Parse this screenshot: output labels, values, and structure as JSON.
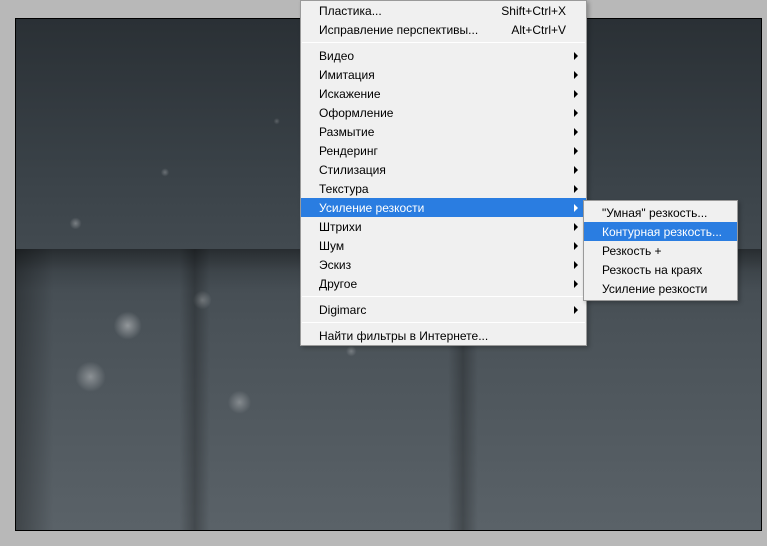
{
  "menu": {
    "plastika_label": "Пластика...",
    "plastika_shortcut": "Shift+Ctrl+X",
    "perspective_label": "Исправление перспективы...",
    "perspective_shortcut": "Alt+Ctrl+V",
    "video_label": "Видео",
    "imitation_label": "Имитация",
    "distort_label": "Искажение",
    "stylize_design_label": "Оформление",
    "blur_label": "Размытие",
    "render_label": "Рендеринг",
    "stylize_label": "Стилизация",
    "texture_label": "Текстура",
    "sharpen_label": "Усиление резкости",
    "strokes_label": "Штрихи",
    "noise_label": "Шум",
    "sketch_label": "Эскиз",
    "other_label": "Другое",
    "digimarc_label": "Digimarc",
    "find_filters_label": "Найти фильтры в Интернете..."
  },
  "submenu": {
    "smart_sharpen_label": "\"Умная\" резкость...",
    "unsharp_mask_label": "Контурная резкость...",
    "sharpen_more_label": "Резкость +",
    "sharpen_edges_label": "Резкость на краях",
    "sharpen_label": "Усиление резкости"
  }
}
